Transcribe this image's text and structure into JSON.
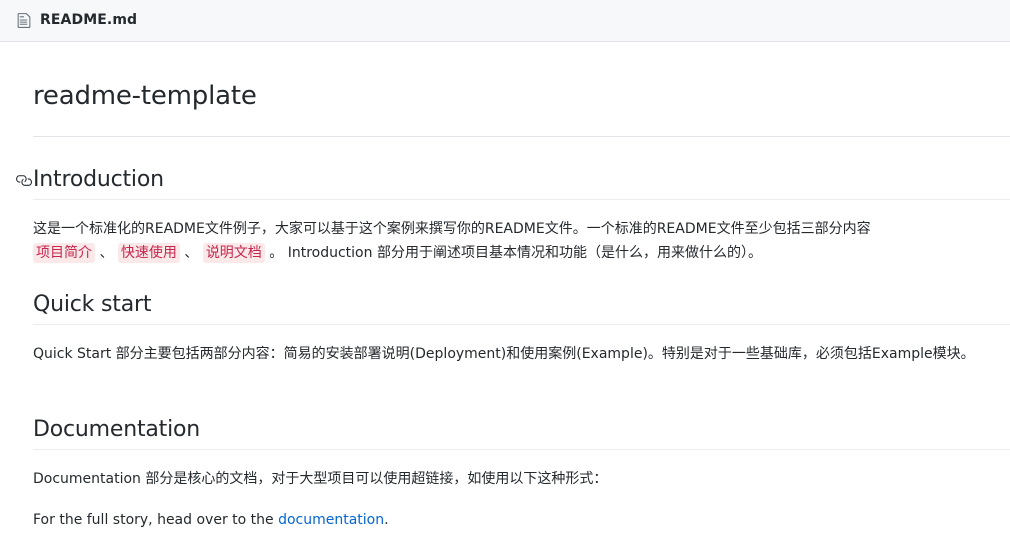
{
  "header": {
    "file_icon": "file-icon",
    "file_name": "README.md"
  },
  "content": {
    "title": "readme-template",
    "sections": [
      {
        "heading": "Introduction",
        "anchor_icon": "link-icon",
        "paragraph_start": "这是一个标准化的README文件例子，大家可以基于这个案例来撰写你的README文件。一个标准的README文件至少包括三部分内容",
        "code_items": [
          "项目简介",
          "快速使用",
          "说明文档"
        ],
        "separator": "、",
        "paragraph_end": "。 Introduction 部分用于阐述项目基本情况和功能（是什么，用来做什么的）。"
      },
      {
        "heading": "Quick start",
        "paragraph": "Quick Start 部分主要包括两部分内容：简易的安装部署说明(Deployment)和使用案例(Example)。特别是对于一些基础库，必须包括Example模块。"
      },
      {
        "heading": "Documentation",
        "paragraph": "Documentation 部分是核心的文档，对于大型项目可以使用超链接，如使用以下这种形式：",
        "paragraph2_prefix": "For the full story, head over to the ",
        "paragraph2_link": "documentation",
        "paragraph2_suffix": "."
      }
    ]
  },
  "colors": {
    "link": "#0366d6",
    "code_text": "#c7254e",
    "code_bg": "#fbe9e9",
    "header_bg": "#f6f8fa"
  }
}
